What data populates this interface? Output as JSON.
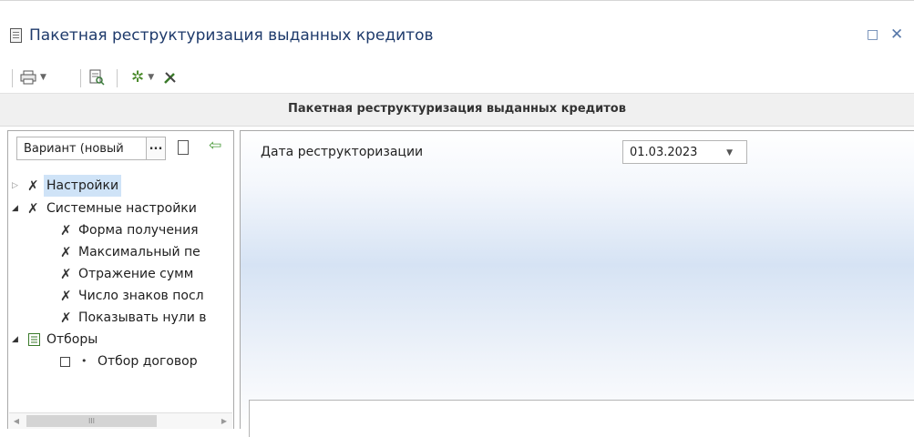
{
  "window": {
    "title": "Пакетная реструктуризация выданных кредитов",
    "maximize_icon": "□",
    "close_icon": "✕"
  },
  "header": {
    "title": "Пакетная реструктуризация выданных кредитов"
  },
  "variant": {
    "value": "Вариант (новый",
    "dots": "..."
  },
  "tree": {
    "nodes": [
      {
        "label": "Настройки",
        "expanded": false,
        "selected": true
      },
      {
        "label": "Системные настройки",
        "expanded": true
      },
      {
        "label": "Форма получения"
      },
      {
        "label": "Максимальный пе"
      },
      {
        "label": "Отражение сумм"
      },
      {
        "label": "Число знаков посл"
      },
      {
        "label": "Показывать нули в"
      },
      {
        "label": "Отборы",
        "expanded": true
      },
      {
        "label": "Отбор договор"
      }
    ]
  },
  "form": {
    "date_label": "Дата реструкторизации",
    "date_value": "01.03.2023"
  },
  "scrollbar": {
    "thumb_label": "III"
  }
}
